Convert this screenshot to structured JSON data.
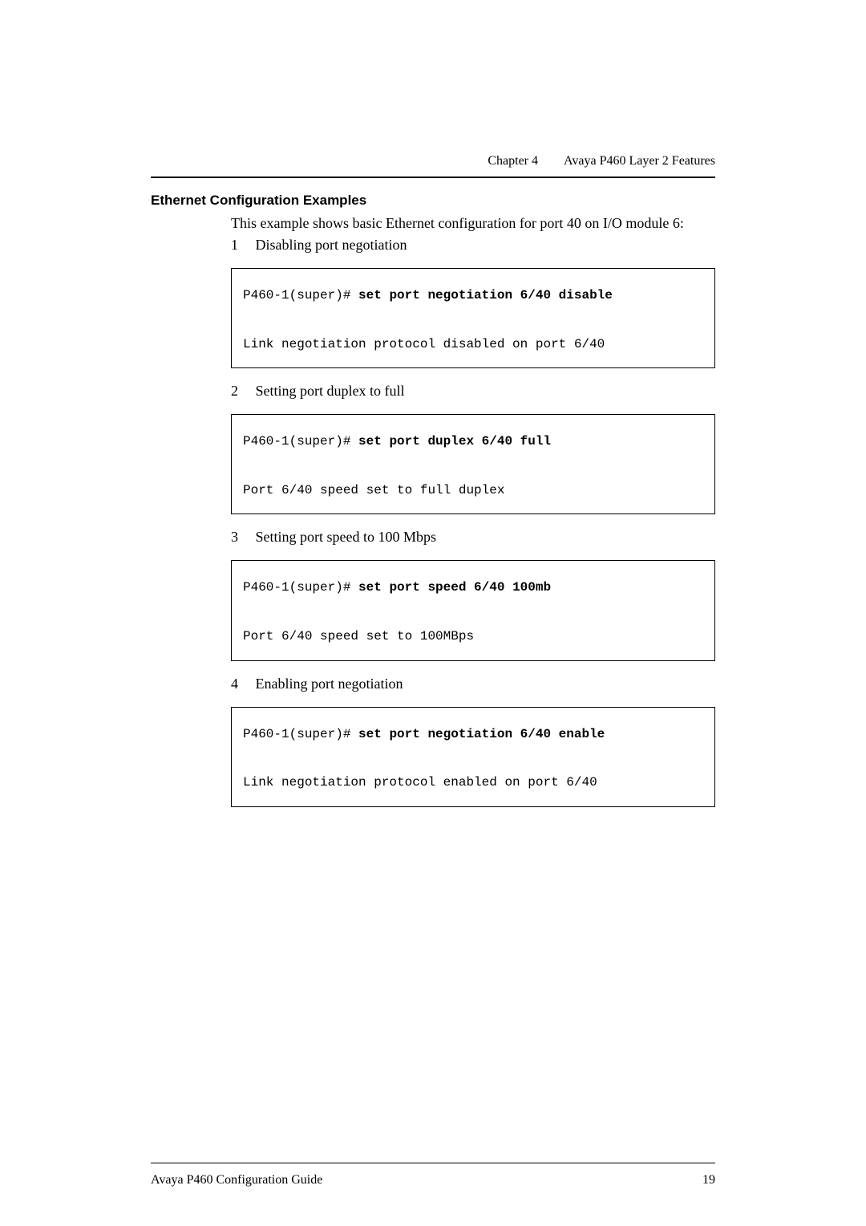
{
  "header": {
    "chapter": "Chapter 4",
    "title": "Avaya P460 Layer 2 Features"
  },
  "section_heading": "Ethernet Configuration Examples",
  "intro": "This example shows basic Ethernet configuration for port 40 on I/O module 6:",
  "steps": [
    {
      "num": "1",
      "label": "Disabling port negotiation",
      "prompt": "P460-1(super)# ",
      "command": "set port negotiation 6/40 disable",
      "output": "Link negotiation protocol disabled on port 6/40"
    },
    {
      "num": "2",
      "label": "Setting port duplex to full",
      "prompt": "P460-1(super)# ",
      "command": "set port duplex 6/40 full",
      "output": "Port 6/40 speed set to full duplex"
    },
    {
      "num": "3",
      "label": "Setting port speed to 100 Mbps",
      "prompt": "P460-1(super)# ",
      "command": "set port speed 6/40 100mb",
      "output": "Port 6/40 speed set to 100MBps"
    },
    {
      "num": "4",
      "label": "Enabling port negotiation",
      "prompt": "P460-1(super)# ",
      "command": "set port negotiation 6/40 enable",
      "output": "Link negotiation protocol enabled on port 6/40"
    }
  ],
  "footer": {
    "left": "Avaya P460 Configuration Guide",
    "right": "19"
  }
}
